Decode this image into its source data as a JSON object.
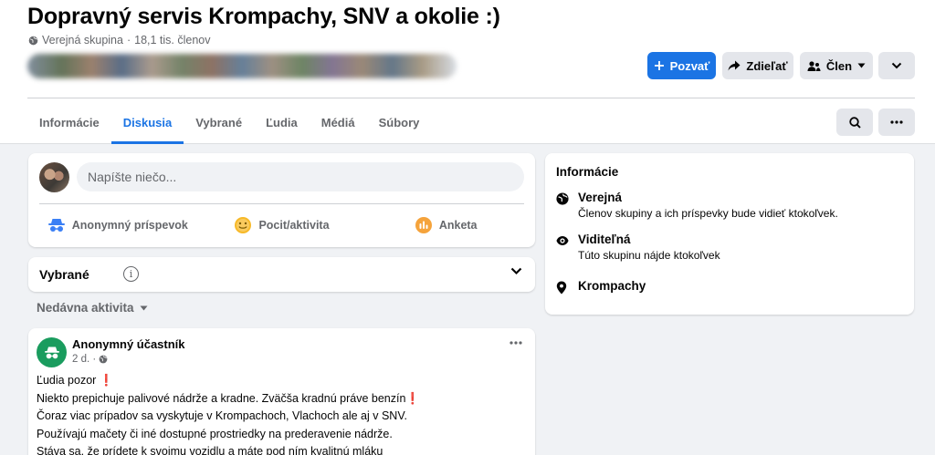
{
  "group": {
    "title": "Dopravný servis Krompachy, SNV a okolie :)",
    "privacy": "Verejná skupina",
    "separator": "·",
    "members": "18,1 tis. členov"
  },
  "actions": {
    "invite": "Pozvať",
    "share": "Zdieľať",
    "member": "Člen"
  },
  "tabs": [
    "Informácie",
    "Diskusia",
    "Vybrané",
    "Ľudia",
    "Médiá",
    "Súbory"
  ],
  "active_tab": "Diskusia",
  "composer": {
    "placeholder": "Napíšte niečo...",
    "anonymous": "Anonymný príspevok",
    "feeling": "Pocit/aktivita",
    "poll": "Anketa"
  },
  "featured": {
    "label": "Vybrané",
    "info": "i"
  },
  "sort": {
    "label": "Nedávna aktivita"
  },
  "post": {
    "author": "Anonymný účastník",
    "time": "2 d. ·",
    "lines": [
      "Ľudia pozor",
      "Niekto prepichuje palivové nádrže a kradne. Zväčša kradnú práve benzín",
      "Čoraz viac prípadov sa vyskytuje v Krompachoch, Vlachoch ale aj v SNV.",
      "Používajú mačety či iné dostupné prostriedky na prederavenie nádrže.",
      "Stáva sa, že prídete k svojmu vozidlu a máte pod ním kvalitnú mláku"
    ],
    "exclamation": "❗"
  },
  "info": {
    "title": "Informácie",
    "public_title": "Verejná",
    "public_desc": "Členov skupiny a ich príspevky bude vidieť ktokoľvek.",
    "visible_title": "Viditeľná",
    "visible_desc": "Túto skupinu nájde ktokoľvek",
    "location": "Krompachy"
  },
  "colors": {
    "accent": "#1b74e4",
    "page_bg": "#f0f2f5",
    "secondary_text": "#65676b",
    "anon_avatar": "#1a9c5e"
  },
  "icons": {
    "privacy": "globe-icon",
    "invite": "plus-icon",
    "share": "share-arrow-icon",
    "member": "members-icon",
    "dropdown": "chevron-down-icon",
    "search": "search-icon",
    "more": "more-dots-icon",
    "anonymous": "anonymous-icon",
    "feeling": "smiley-icon",
    "poll": "poll-icon",
    "location": "location-pin-icon",
    "visibility": "eye-icon"
  }
}
